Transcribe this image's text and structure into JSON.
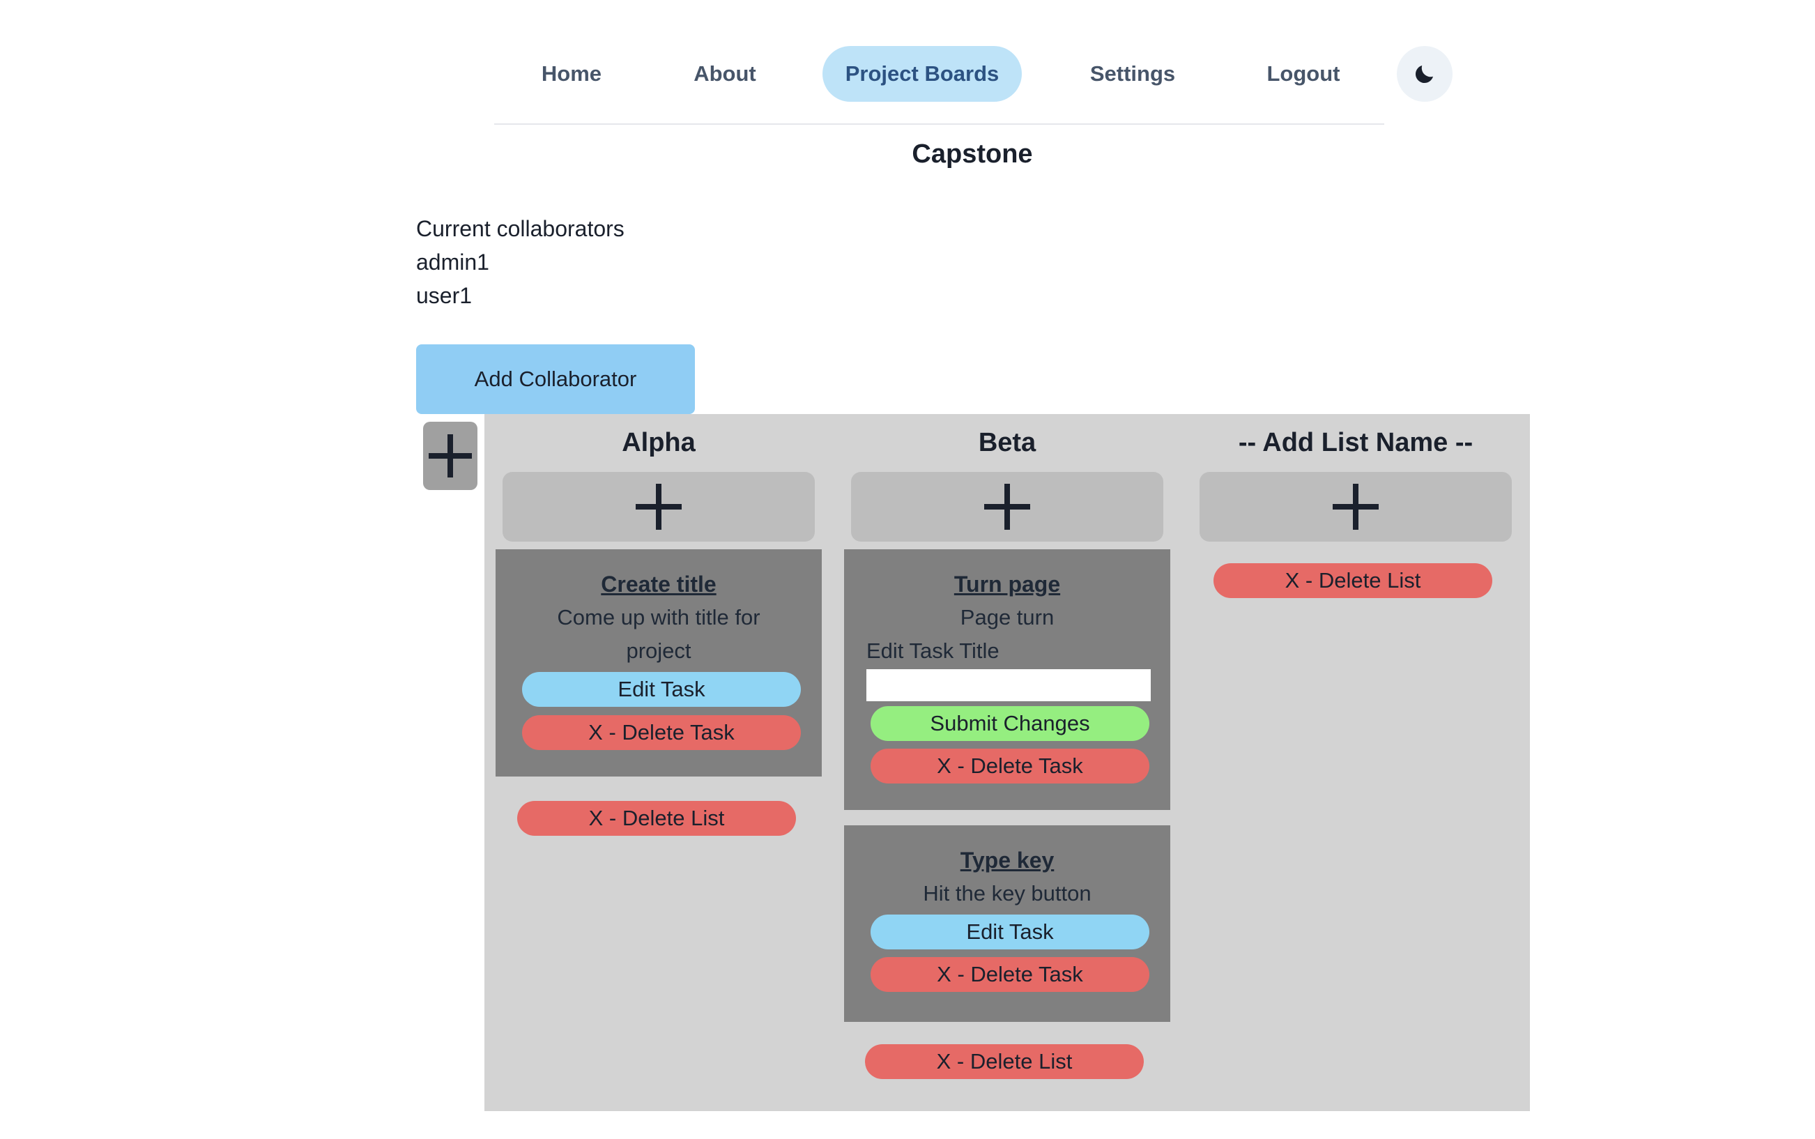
{
  "nav": {
    "items": [
      {
        "label": "Home"
      },
      {
        "label": "About"
      },
      {
        "label": "Project Boards",
        "active": true
      },
      {
        "label": "Settings"
      },
      {
        "label": "Logout"
      }
    ],
    "theme_icon": "moon-icon"
  },
  "board": {
    "title": "Capstone",
    "collaborators_heading": "Current collaborators",
    "collaborators": [
      "admin1",
      "user1"
    ],
    "add_collaborator_label": "Add Collaborator",
    "add_list_icon": "plus-icon",
    "lists": [
      {
        "title": "Alpha",
        "add_task_icon": "plus-icon",
        "delete_list_label": "X - Delete List",
        "tasks": [
          {
            "title": "Create title",
            "description": "Come up with title for project",
            "edit_label": "Edit Task",
            "delete_label": "X - Delete Task"
          }
        ]
      },
      {
        "title": "Beta",
        "add_task_icon": "plus-icon",
        "delete_list_label": "X - Delete List",
        "tasks": [
          {
            "title": "Turn page",
            "description": "Page turn",
            "edit_field_label": "Edit Task Title",
            "edit_field_value": "",
            "submit_label": "Submit Changes",
            "delete_label": "X - Delete Task"
          },
          {
            "title": "Type key",
            "description": "Hit the key button",
            "edit_label": "Edit Task",
            "delete_label": "X - Delete Task"
          }
        ]
      },
      {
        "title": "-- Add List Name --",
        "add_task_icon": "plus-icon",
        "delete_list_label": "X - Delete List",
        "tasks": []
      }
    ]
  },
  "colors": {
    "nav_active_bg": "#bee3f8",
    "primary_button": "#90cdf4",
    "danger_button": "#e66a66",
    "success_button": "#95ee80",
    "board_bg": "#d3d3d3",
    "card_bg": "#808080"
  }
}
